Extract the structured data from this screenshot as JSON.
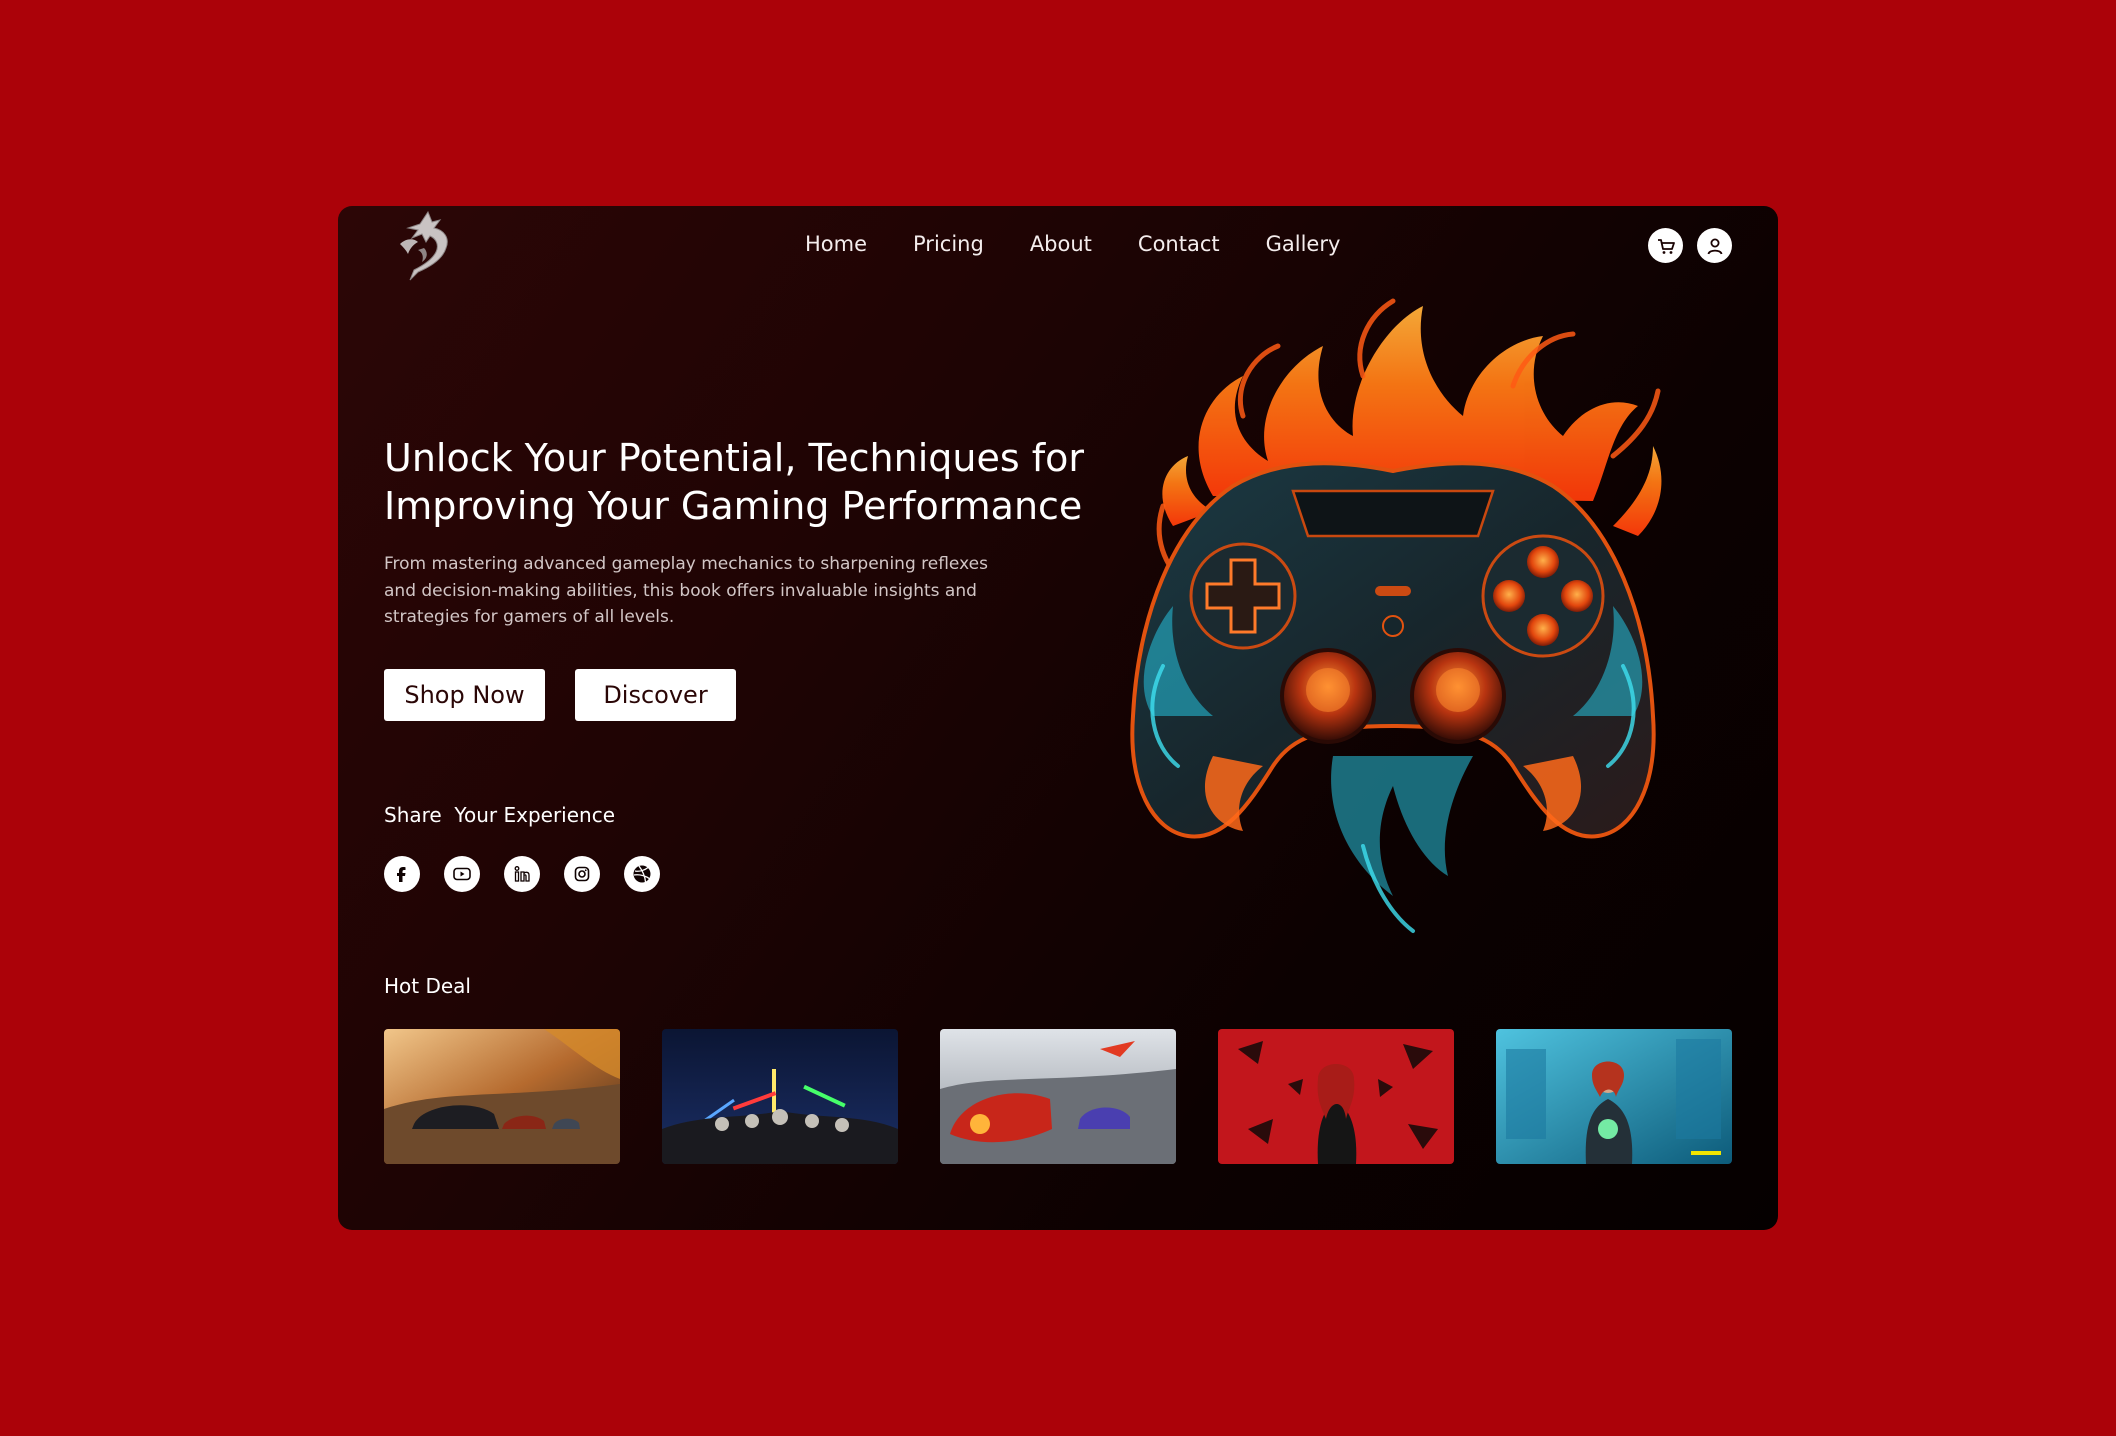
{
  "colors": {
    "background": "#ab0209",
    "panel": "#1e0404",
    "text": "#ffffff",
    "button_text": "#2a0606"
  },
  "header": {
    "logo_icon": "dragon-logo-icon",
    "nav": [
      "Home",
      "Pricing",
      "About",
      "Contact",
      "Gallery"
    ],
    "cart_icon": "cart-icon",
    "user_icon": "user-icon"
  },
  "hero": {
    "title_line1": "Unlock Your Potential, Techniques for",
    "title_line2": "Improving Your Gaming Performance",
    "description": "From mastering advanced gameplay mechanics to sharpening reflexes and decision-making abilities, this book offers invaluable insights and strategies for gamers of all levels.",
    "shop_label": "Shop Now",
    "discover_label": "Discover",
    "art_icon": "flaming-game-controller-icon"
  },
  "share": {
    "title": "Share  Your Experience",
    "icons": [
      "facebook-icon",
      "youtube-icon",
      "linkedin-icon",
      "instagram-icon",
      "dribbble-icon"
    ]
  },
  "hot_deal": {
    "title": "Hot Deal",
    "items": [
      "racing-game-thumbnail",
      "lego-star-wars-thumbnail",
      "racing-cars-thumbnail",
      "red-hair-heroine-thumbnail",
      "cyberpunk-thumbnail"
    ]
  }
}
